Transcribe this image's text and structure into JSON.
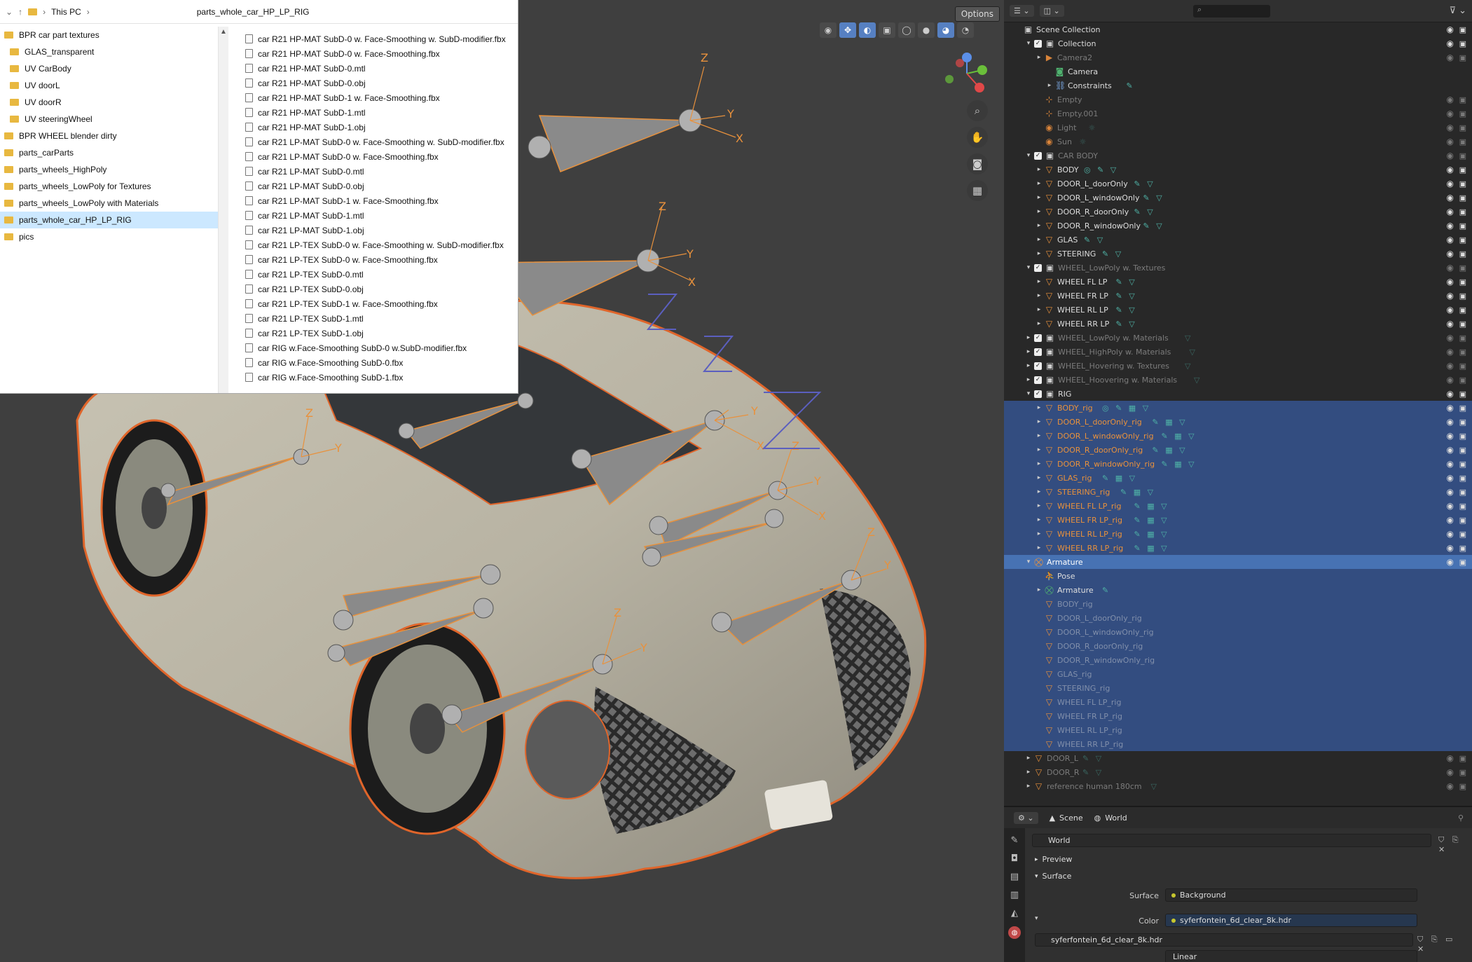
{
  "explorer": {
    "breadcrumb": [
      "This PC"
    ],
    "path_title": "parts_whole_car_HP_LP_RIG",
    "folders": [
      {
        "label": "BPR car part textures",
        "indent": false,
        "selected": false
      },
      {
        "label": "GLAS_transparent",
        "indent": true,
        "selected": false
      },
      {
        "label": "UV CarBody",
        "indent": true,
        "selected": false
      },
      {
        "label": "UV doorL",
        "indent": true,
        "selected": false
      },
      {
        "label": "UV doorR",
        "indent": true,
        "selected": false
      },
      {
        "label": "UV steeringWheel",
        "indent": true,
        "selected": false
      },
      {
        "label": "BPR WHEEL blender dirty",
        "indent": false,
        "selected": false
      },
      {
        "label": "parts_carParts",
        "indent": false,
        "selected": false
      },
      {
        "label": "parts_wheels_HighPoly",
        "indent": false,
        "selected": false
      },
      {
        "label": "parts_wheels_LowPoly for Textures",
        "indent": false,
        "selected": false
      },
      {
        "label": "parts_wheels_LowPoly with Materials",
        "indent": false,
        "selected": false
      },
      {
        "label": "parts_whole_car_HP_LP_RIG",
        "indent": false,
        "selected": true
      },
      {
        "label": "pics",
        "indent": false,
        "selected": false
      }
    ],
    "files": [
      "car R21 HP-MAT SubD-0 w. Face-Smoothing w. SubD-modifier.fbx",
      "car R21 HP-MAT SubD-0 w. Face-Smoothing.fbx",
      "car R21 HP-MAT SubD-0.mtl",
      "car R21 HP-MAT SubD-0.obj",
      "car R21 HP-MAT SubD-1 w. Face-Smoothing.fbx",
      "car R21 HP-MAT SubD-1.mtl",
      "car R21 HP-MAT SubD-1.obj",
      "car R21 LP-MAT SubD-0 w. Face-Smoothing w. SubD-modifier.fbx",
      "car R21 LP-MAT SubD-0 w. Face-Smoothing.fbx",
      "car R21 LP-MAT SubD-0.mtl",
      "car R21 LP-MAT SubD-0.obj",
      "car R21 LP-MAT SubD-1 w. Face-Smoothing.fbx",
      "car R21 LP-MAT SubD-1.mtl",
      "car R21 LP-MAT SubD-1.obj",
      "car R21 LP-TEX SubD-0 w. Face-Smoothing w. SubD-modifier.fbx",
      "car R21 LP-TEX SubD-0 w. Face-Smoothing.fbx",
      "car R21 LP-TEX SubD-0.mtl",
      "car R21 LP-TEX SubD-0.obj",
      "car R21 LP-TEX SubD-1 w. Face-Smoothing.fbx",
      "car R21 LP-TEX SubD-1.mtl",
      "car R21 LP-TEX SubD-1.obj",
      "car RIG w.Face-Smoothing SubD-0 w.SubD-modifier.fbx",
      "car RIG w.Face-Smoothing SubD-0.fbx",
      "car RIG w.Face-Smoothing SubD-1.fbx"
    ]
  },
  "viewport": {
    "options_label": "Options"
  },
  "outliner": {
    "search_placeholder": "",
    "rows": [
      {
        "label": "Scene Collection",
        "depth": 0,
        "expand": "",
        "check": false,
        "icon": "collection",
        "state": "normal",
        "extras": ""
      },
      {
        "label": "Collection",
        "depth": 1,
        "expand": "▾",
        "check": true,
        "icon": "collection",
        "state": "normal",
        "extras": ""
      },
      {
        "label": "Camera2",
        "depth": 2,
        "expand": "▸",
        "check": false,
        "icon": "camera",
        "state": "dim",
        "extras": ""
      },
      {
        "label": "Camera",
        "depth": 3,
        "expand": "",
        "check": false,
        "icon": "camera-data",
        "state": "normal",
        "extras": ""
      },
      {
        "label": "Constraints",
        "depth": 3,
        "expand": "▸",
        "check": false,
        "icon": "constraint",
        "state": "normal",
        "extras": "✎"
      },
      {
        "label": "Empty",
        "depth": 2,
        "expand": "",
        "check": false,
        "icon": "empty",
        "state": "dim",
        "extras": ""
      },
      {
        "label": "Empty.001",
        "depth": 2,
        "expand": "",
        "check": false,
        "icon": "empty",
        "state": "dim",
        "extras": ""
      },
      {
        "label": "Light",
        "depth": 2,
        "expand": "",
        "check": false,
        "icon": "light",
        "state": "dim",
        "extras": "☼"
      },
      {
        "label": "Sun",
        "depth": 2,
        "expand": "",
        "check": false,
        "icon": "light",
        "state": "dim",
        "extras": "☼"
      },
      {
        "label": "CAR BODY",
        "depth": 1,
        "expand": "▾",
        "check": true,
        "icon": "collection",
        "state": "dim",
        "extras": ""
      },
      {
        "label": "BODY",
        "depth": 2,
        "expand": "▸",
        "check": false,
        "icon": "mesh",
        "state": "normal",
        "extras": "◎ ✎ ▽"
      },
      {
        "label": "DOOR_L_doorOnly",
        "depth": 2,
        "expand": "▸",
        "check": false,
        "icon": "mesh",
        "state": "normal",
        "extras": "✎ ▽"
      },
      {
        "label": "DOOR_L_windowOnly",
        "depth": 2,
        "expand": "▸",
        "check": false,
        "icon": "mesh",
        "state": "normal",
        "extras": "✎ ▽"
      },
      {
        "label": "DOOR_R_doorOnly",
        "depth": 2,
        "expand": "▸",
        "check": false,
        "icon": "mesh",
        "state": "normal",
        "extras": "✎ ▽"
      },
      {
        "label": "DOOR_R_windowOnly",
        "depth": 2,
        "expand": "▸",
        "check": false,
        "icon": "mesh",
        "state": "normal",
        "extras": "✎ ▽"
      },
      {
        "label": "GLAS",
        "depth": 2,
        "expand": "▸",
        "check": false,
        "icon": "mesh",
        "state": "normal",
        "extras": "✎ ▽"
      },
      {
        "label": "STEERING",
        "depth": 2,
        "expand": "▸",
        "check": false,
        "icon": "mesh",
        "state": "normal",
        "extras": "✎ ▽"
      },
      {
        "label": "WHEEL_LowPoly w. Textures",
        "depth": 1,
        "expand": "▾",
        "check": true,
        "icon": "collection",
        "state": "dim",
        "extras": ""
      },
      {
        "label": "WHEEL FL LP",
        "depth": 2,
        "expand": "▸",
        "check": false,
        "icon": "mesh",
        "state": "normal",
        "extras": "✎ ▽"
      },
      {
        "label": "WHEEL FR LP",
        "depth": 2,
        "expand": "▸",
        "check": false,
        "icon": "mesh",
        "state": "normal",
        "extras": "✎ ▽"
      },
      {
        "label": "WHEEL RL LP",
        "depth": 2,
        "expand": "▸",
        "check": false,
        "icon": "mesh",
        "state": "normal",
        "extras": "✎ ▽"
      },
      {
        "label": "WHEEL RR LP",
        "depth": 2,
        "expand": "▸",
        "check": false,
        "icon": "mesh",
        "state": "normal",
        "extras": "✎ ▽"
      },
      {
        "label": "WHEEL_LowPoly w. Materials",
        "depth": 1,
        "expand": "▸",
        "check": true,
        "icon": "collection",
        "state": "dim",
        "extras": "▽"
      },
      {
        "label": "WHEEL_HighPoly w. Materials",
        "depth": 1,
        "expand": "▸",
        "check": true,
        "icon": "collection",
        "state": "dim",
        "extras": "▽"
      },
      {
        "label": "WHEEL_Hovering w. Textures",
        "depth": 1,
        "expand": "▸",
        "check": true,
        "icon": "collection",
        "state": "dim",
        "extras": "▽"
      },
      {
        "label": "WHEEL_Hoovering w. Materials",
        "depth": 1,
        "expand": "▸",
        "check": true,
        "icon": "collection",
        "state": "dim",
        "extras": "▽"
      },
      {
        "label": "RIG",
        "depth": 1,
        "expand": "▾",
        "check": true,
        "icon": "collection",
        "state": "normal",
        "extras": ""
      },
      {
        "label": "BODY_rig",
        "depth": 2,
        "expand": "▸",
        "check": false,
        "icon": "mesh",
        "state": "sel-orange",
        "extras": "◎ ✎ ▦ ▽"
      },
      {
        "label": "DOOR_L_doorOnly_rig",
        "depth": 2,
        "expand": "▸",
        "check": false,
        "icon": "mesh",
        "state": "sel-orange",
        "extras": "✎ ▦ ▽"
      },
      {
        "label": "DOOR_L_windowOnly_rig",
        "depth": 2,
        "expand": "▸",
        "check": false,
        "icon": "mesh",
        "state": "sel-orange",
        "extras": "✎ ▦ ▽"
      },
      {
        "label": "DOOR_R_doorOnly_rig",
        "depth": 2,
        "expand": "▸",
        "check": false,
        "icon": "mesh",
        "state": "sel-orange",
        "extras": "✎ ▦ ▽"
      },
      {
        "label": "DOOR_R_windowOnly_rig",
        "depth": 2,
        "expand": "▸",
        "check": false,
        "icon": "mesh",
        "state": "sel-orange",
        "extras": "✎ ▦ ▽"
      },
      {
        "label": "GLAS_rig",
        "depth": 2,
        "expand": "▸",
        "check": false,
        "icon": "mesh",
        "state": "sel-orange",
        "extras": "✎ ▦ ▽"
      },
      {
        "label": "STEERING_rig",
        "depth": 2,
        "expand": "▸",
        "check": false,
        "icon": "mesh",
        "state": "sel-orange",
        "extras": "✎ ▦ ▽"
      },
      {
        "label": "WHEEL FL LP_rig",
        "depth": 2,
        "expand": "▸",
        "check": false,
        "icon": "mesh",
        "state": "sel-orange",
        "extras": "✎ ▦ ▽"
      },
      {
        "label": "WHEEL FR LP_rig",
        "depth": 2,
        "expand": "▸",
        "check": false,
        "icon": "mesh",
        "state": "sel-orange",
        "extras": "✎ ▦ ▽"
      },
      {
        "label": "WHEEL RL LP_rig",
        "depth": 2,
        "expand": "▸",
        "check": false,
        "icon": "mesh",
        "state": "sel-orange",
        "extras": "✎ ▦ ▽"
      },
      {
        "label": "WHEEL RR LP_rig",
        "depth": 2,
        "expand": "▸",
        "check": false,
        "icon": "mesh",
        "state": "sel-orange",
        "extras": "✎ ▦ ▽"
      },
      {
        "label": "Armature",
        "depth": 1,
        "expand": "▾",
        "check": false,
        "icon": "armature",
        "state": "active",
        "extras": ""
      },
      {
        "label": "Pose",
        "depth": 2,
        "expand": "",
        "check": false,
        "icon": "pose",
        "state": "sel",
        "extras": ""
      },
      {
        "label": "Armature",
        "depth": 2,
        "expand": "▸",
        "check": false,
        "icon": "armature-data",
        "state": "sel",
        "extras": "✎"
      },
      {
        "label": "BODY_rig",
        "depth": 2,
        "expand": "",
        "check": false,
        "icon": "mesh",
        "state": "sel-dim",
        "extras": ""
      },
      {
        "label": "DOOR_L_doorOnly_rig",
        "depth": 2,
        "expand": "",
        "check": false,
        "icon": "mesh",
        "state": "sel-dim",
        "extras": ""
      },
      {
        "label": "DOOR_L_windowOnly_rig",
        "depth": 2,
        "expand": "",
        "check": false,
        "icon": "mesh",
        "state": "sel-dim",
        "extras": ""
      },
      {
        "label": "DOOR_R_doorOnly_rig",
        "depth": 2,
        "expand": "",
        "check": false,
        "icon": "mesh",
        "state": "sel-dim",
        "extras": ""
      },
      {
        "label": "DOOR_R_windowOnly_rig",
        "depth": 2,
        "expand": "",
        "check": false,
        "icon": "mesh",
        "state": "sel-dim",
        "extras": ""
      },
      {
        "label": "GLAS_rig",
        "depth": 2,
        "expand": "",
        "check": false,
        "icon": "mesh",
        "state": "sel-dim",
        "extras": ""
      },
      {
        "label": "STEERING_rig",
        "depth": 2,
        "expand": "",
        "check": false,
        "icon": "mesh",
        "state": "sel-dim",
        "extras": ""
      },
      {
        "label": "WHEEL FL LP_rig",
        "depth": 2,
        "expand": "",
        "check": false,
        "icon": "mesh",
        "state": "sel-dim",
        "extras": ""
      },
      {
        "label": "WHEEL FR LP_rig",
        "depth": 2,
        "expand": "",
        "check": false,
        "icon": "mesh",
        "state": "sel-dim",
        "extras": ""
      },
      {
        "label": "WHEEL RL LP_rig",
        "depth": 2,
        "expand": "",
        "check": false,
        "icon": "mesh",
        "state": "sel-dim",
        "extras": ""
      },
      {
        "label": "WHEEL RR LP_rig",
        "depth": 2,
        "expand": "",
        "check": false,
        "icon": "mesh",
        "state": "sel-dim",
        "extras": ""
      },
      {
        "label": "DOOR_L",
        "depth": 1,
        "expand": "▸",
        "check": false,
        "icon": "mesh",
        "state": "dim",
        "extras": "✎ ▽"
      },
      {
        "label": "DOOR_R",
        "depth": 1,
        "expand": "▸",
        "check": false,
        "icon": "mesh",
        "state": "dim",
        "extras": "✎ ▽"
      },
      {
        "label": "reference human 180cm",
        "depth": 1,
        "expand": "▸",
        "check": false,
        "icon": "mesh",
        "state": "dim",
        "extras": "▽"
      }
    ]
  },
  "properties": {
    "tabs": [
      "Scene",
      "World"
    ],
    "world_name": "World",
    "panel_preview": "Preview",
    "panel_surface": "Surface",
    "surface_label": "Surface",
    "surface_value": "Background",
    "color_label": "Color",
    "color_value": "syferfontein_6d_clear_8k.hdr",
    "image_name": "syferfontein_6d_clear_8k.hdr",
    "interpolation": "Linear"
  },
  "colors": {
    "selection": "#334d80",
    "active": "#4772b3",
    "orange_select": "#e8913c",
    "explorer_selected": "#cce8ff"
  }
}
